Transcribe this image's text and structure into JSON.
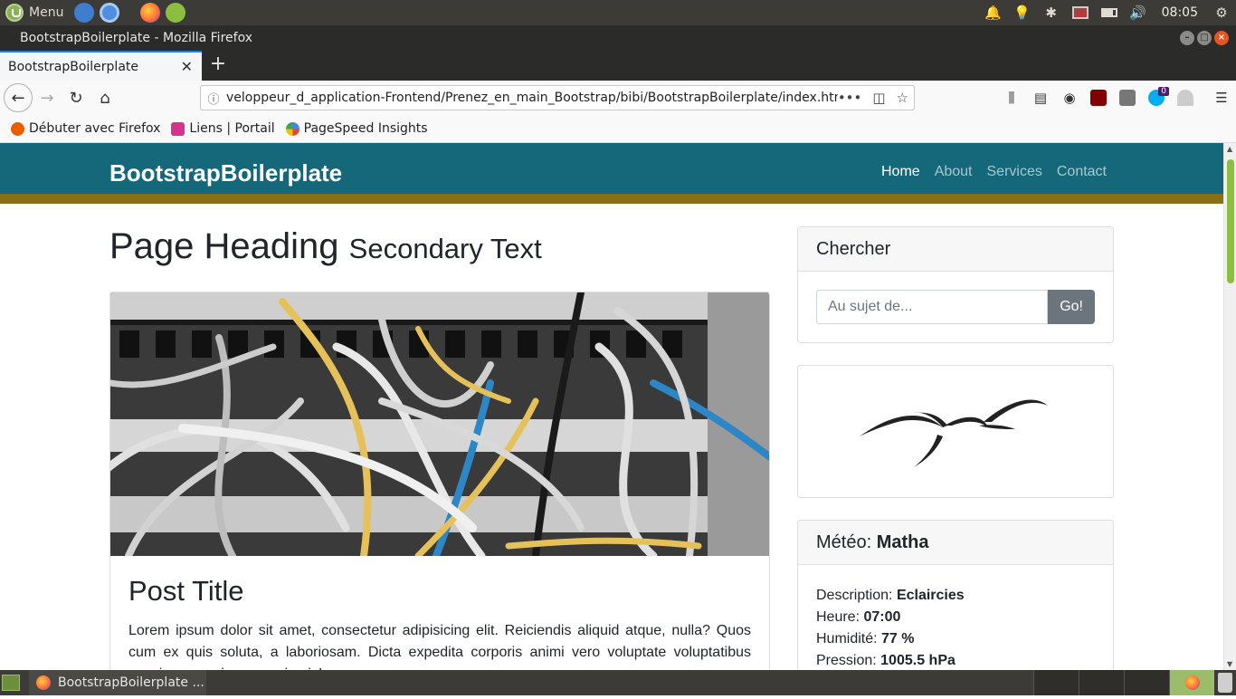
{
  "os_panel": {
    "menu_label": "Menu",
    "clock": "08:05"
  },
  "window": {
    "title": "BootstrapBoilerplate - Mozilla Firefox"
  },
  "tabs": [
    {
      "label": "BootstrapBoilerplate"
    }
  ],
  "url_bar": {
    "url": "veloppeur_d_application-Frontend/Prenez_en_main_Bootstrap/bibi/BootstrapBoilerplate/index.html",
    "more": "•••"
  },
  "addons": {
    "notification_count": "0"
  },
  "bookmarks": [
    {
      "label": "Débuter avec Firefox",
      "color": "#e66000"
    },
    {
      "label": "Liens | Portail",
      "color": "#d6338e"
    },
    {
      "label": "PageSpeed Insights",
      "color": "#4285f4"
    }
  ],
  "site": {
    "brand": "BootstrapBoilerplate",
    "nav": [
      "Home",
      "About",
      "Services",
      "Contact"
    ],
    "heading": "Page Heading",
    "heading_secondary": "Secondary Text",
    "post": {
      "title": "Post Title",
      "text": "Lorem ipsum dolor sit amet, consectetur adipisicing elit. Reiciendis aliquid atque, nulla? Quos cum ex quis soluta, a laboriosam. Dicta expedita corporis animi vero voluptate voluptatibus possimus, veniam magni quis!"
    },
    "search": {
      "title": "Chercher",
      "placeholder": "Au sujet de...",
      "button": "Go!"
    },
    "weather": {
      "title_prefix": "Météo:",
      "city": "Matha",
      "rows": [
        {
          "label": "Description:",
          "value": "Eclaircies"
        },
        {
          "label": "Heure:",
          "value": "07:00"
        },
        {
          "label": "Humidité:",
          "value": "77 %"
        },
        {
          "label": "Pression:",
          "value": "1005.5 hPa"
        }
      ]
    }
  },
  "taskbar": {
    "task_label": "BootstrapBoilerplate ..."
  },
  "colors": {
    "navbar": "#156879",
    "navbar_border": "#8a6f14",
    "accent_tab": "#0a84ff"
  }
}
